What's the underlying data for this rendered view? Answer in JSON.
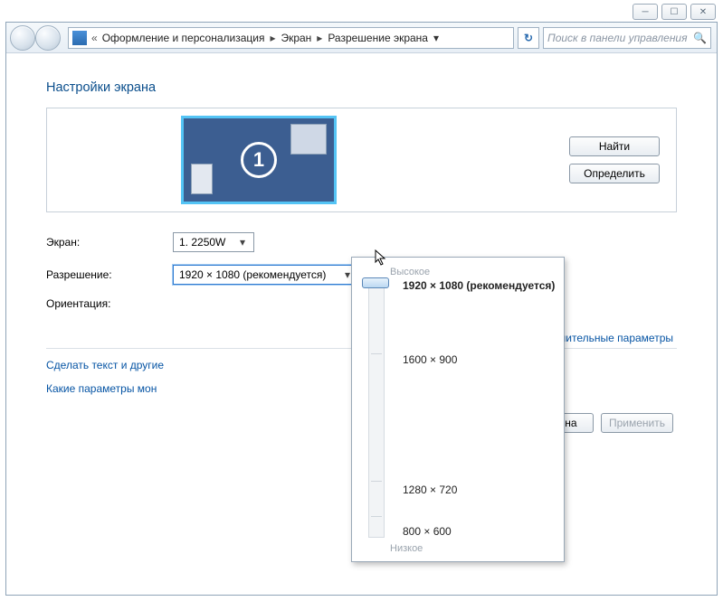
{
  "window_buttons": {
    "min": "─",
    "max": "☐",
    "close": "✕"
  },
  "breadcrumb": {
    "prefix": "«",
    "items": [
      "Оформление и персонализация",
      "Экран",
      "Разрешение экрана"
    ]
  },
  "search": {
    "placeholder": "Поиск в панели управления"
  },
  "heading": "Настройки экрана",
  "monitor_number": "1",
  "buttons": {
    "find": "Найти",
    "identify": "Определить"
  },
  "form": {
    "screen_label": "Экран:",
    "screen_value": "1. 2250W",
    "resolution_label": "Разрешение:",
    "resolution_value": "1920 × 1080 (рекомендуется)",
    "orientation_label": "Ориентация:"
  },
  "right_link": "Дополнительные параметры",
  "links": {
    "text_scale": "Сделать текст и другие",
    "which_params": "Какие параметры мон"
  },
  "footer": {
    "ok_hidden": "",
    "cancel": "Отмена",
    "apply": "Применить"
  },
  "res_popup": {
    "top": "Высокое",
    "bottom": "Низкое",
    "items": [
      "1920 × 1080 (рекомендуется)",
      "1600 × 900",
      "1280 × 720",
      "800 × 600"
    ]
  }
}
